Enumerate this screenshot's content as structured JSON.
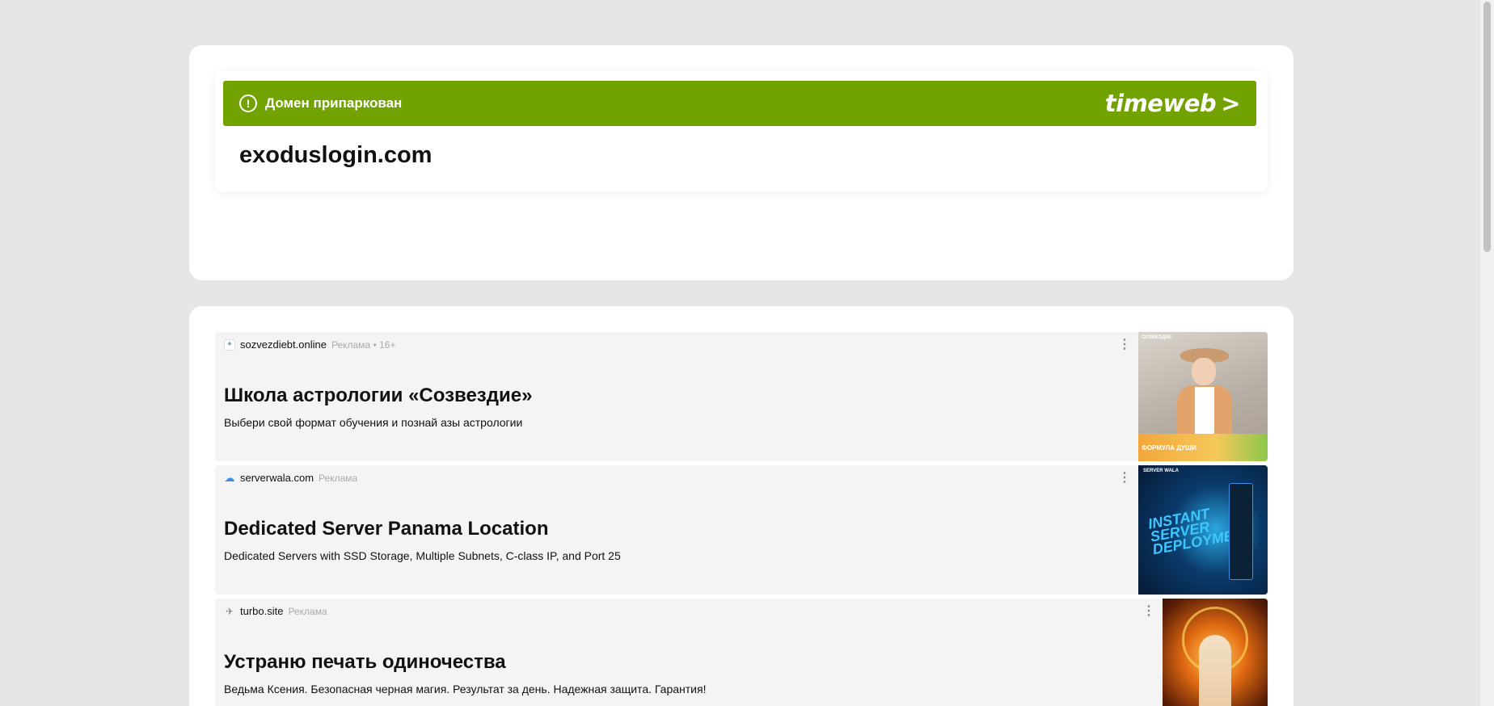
{
  "parked": {
    "status_text": "Домен припаркован",
    "brand": "timeweb",
    "brand_arrow": ">",
    "domain": "exoduslogin.com",
    "alert_glyph": "!"
  },
  "ads": [
    {
      "domain": "sozvezdiebt.online",
      "label": "Реклама • 16+",
      "title": "Школа астрологии «Созвездие»",
      "description": "Выбери свой формат обучения и познай азы астрологии",
      "thumb_caption": "ФОРМУЛА ДУШИ",
      "thumb_logo": "СОЗВЕЗДИЕ"
    },
    {
      "domain": "serverwala.com",
      "label": "Реклама",
      "title": "Dedicated Server Panama Location",
      "description": "Dedicated Servers with SSD Storage, Multiple Subnets, C-class IP, and Port 25",
      "thumb_logo": "SERVER WALA",
      "thumb_text": "INSTANT SERVER DEPLOYMENT"
    },
    {
      "domain": "turbo.site",
      "label": "Реклама",
      "title": "Устраню печать одиночества",
      "description": "Ведьма Ксения. Безопасная черная магия. Результат за день. Надежная защита. Гарантия!"
    }
  ],
  "icons": {
    "menu": "⋮",
    "fav1": "✦",
    "fav2": "☁",
    "fav3": "✈"
  },
  "colors": {
    "parked_bar": "#71a200",
    "page_bg": "#e6e6e6"
  }
}
